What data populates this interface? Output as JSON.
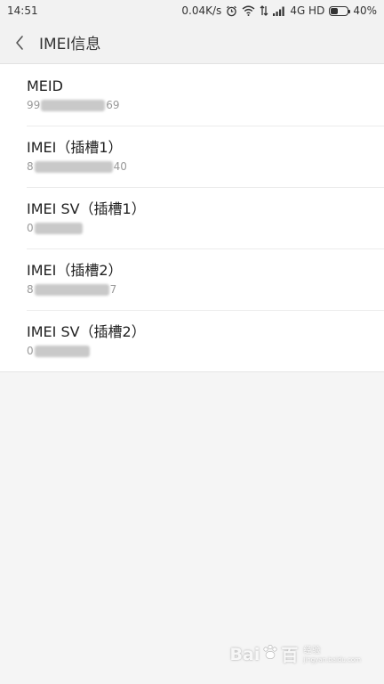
{
  "status_bar": {
    "time": "14:51",
    "net_speed": "0.04K/s",
    "network": "4G HD",
    "battery_percent": "40%",
    "battery_level": 0.4,
    "icons": [
      "alarm-icon",
      "wifi-icon",
      "data-arrows-icon",
      "signal-icon",
      "battery-icon"
    ]
  },
  "header": {
    "title": "IMEI信息",
    "back_icon": "chevron-left-icon"
  },
  "items": [
    {
      "label": "MEID",
      "value_start": "99",
      "value_end": "69"
    },
    {
      "label": "IMEI（插槽1）",
      "value_start": "8",
      "value_end": "40"
    },
    {
      "label": "IMEI SV（插槽1）",
      "value_start": "0",
      "value_end": ""
    },
    {
      "label": "IMEI（插槽2）",
      "value_start": "8",
      "value_end": "7"
    },
    {
      "label": "IMEI SV（插槽2）",
      "value_start": "0",
      "value_end": ""
    }
  ],
  "watermark": {
    "brand": "Bai",
    "brand_end": "百",
    "sub": "经验",
    "url": "jingyan.baidu.com"
  }
}
